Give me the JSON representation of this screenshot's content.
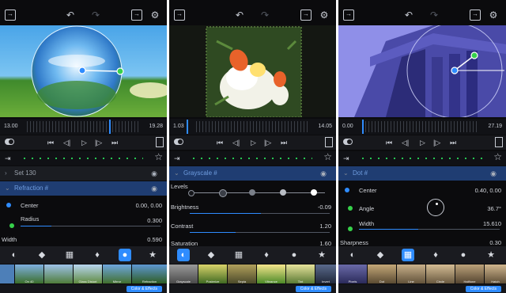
{
  "icons": [
    "import-icon",
    "undo-icon",
    "redo-icon",
    "export-icon",
    "settings-icon"
  ],
  "accent": "#2f8cff",
  "panels": [
    {
      "timeline": {
        "start": "13.00",
        "end": "19.28"
      },
      "layers": [
        {
          "name": "Set 130"
        },
        {
          "name": "Refraction #"
        }
      ],
      "params": [
        {
          "label": "Center",
          "value": "0.00, 0.00"
        },
        {
          "label": "Radius",
          "value": "0.300"
        },
        {
          "label": "Width",
          "value": "0.590"
        }
      ],
      "thumbs": [
        "",
        "On 40",
        "",
        "Glass Distort",
        "Mirror",
        "Refraction"
      ],
      "bottom_label": "Color & Effects"
    },
    {
      "timeline": {
        "start": "1.03",
        "end": "14.05"
      },
      "layers": [
        {
          "name": "Grayscale #"
        }
      ],
      "params": [
        {
          "label": "Levels",
          "value": ""
        },
        {
          "label": "Brightness",
          "value": "-0.09"
        },
        {
          "label": "Contrast",
          "value": "1.20"
        },
        {
          "label": "Saturation",
          "value": "1.60"
        }
      ],
      "thumbs": [
        "Grayscale",
        "Posterize",
        "Sepia",
        "Vibrance",
        "Tint",
        "Invert"
      ],
      "bottom_label": "Color & Effects"
    },
    {
      "timeline": {
        "start": "0.00",
        "end": "27.19"
      },
      "layers": [
        {
          "name": "Dot #"
        }
      ],
      "params": [
        {
          "label": "Center",
          "value": "0.40, 0.00"
        },
        {
          "label": "Angle",
          "value": "36.7°"
        },
        {
          "label": "Width",
          "value": "15.610"
        },
        {
          "label": "Sharpness",
          "value": "0.30"
        }
      ],
      "thumbs": [
        "Pixels",
        "Dot",
        "Line",
        "Circle",
        "Halftone",
        "Hatch"
      ],
      "bottom_label": "Color & Effects"
    }
  ]
}
